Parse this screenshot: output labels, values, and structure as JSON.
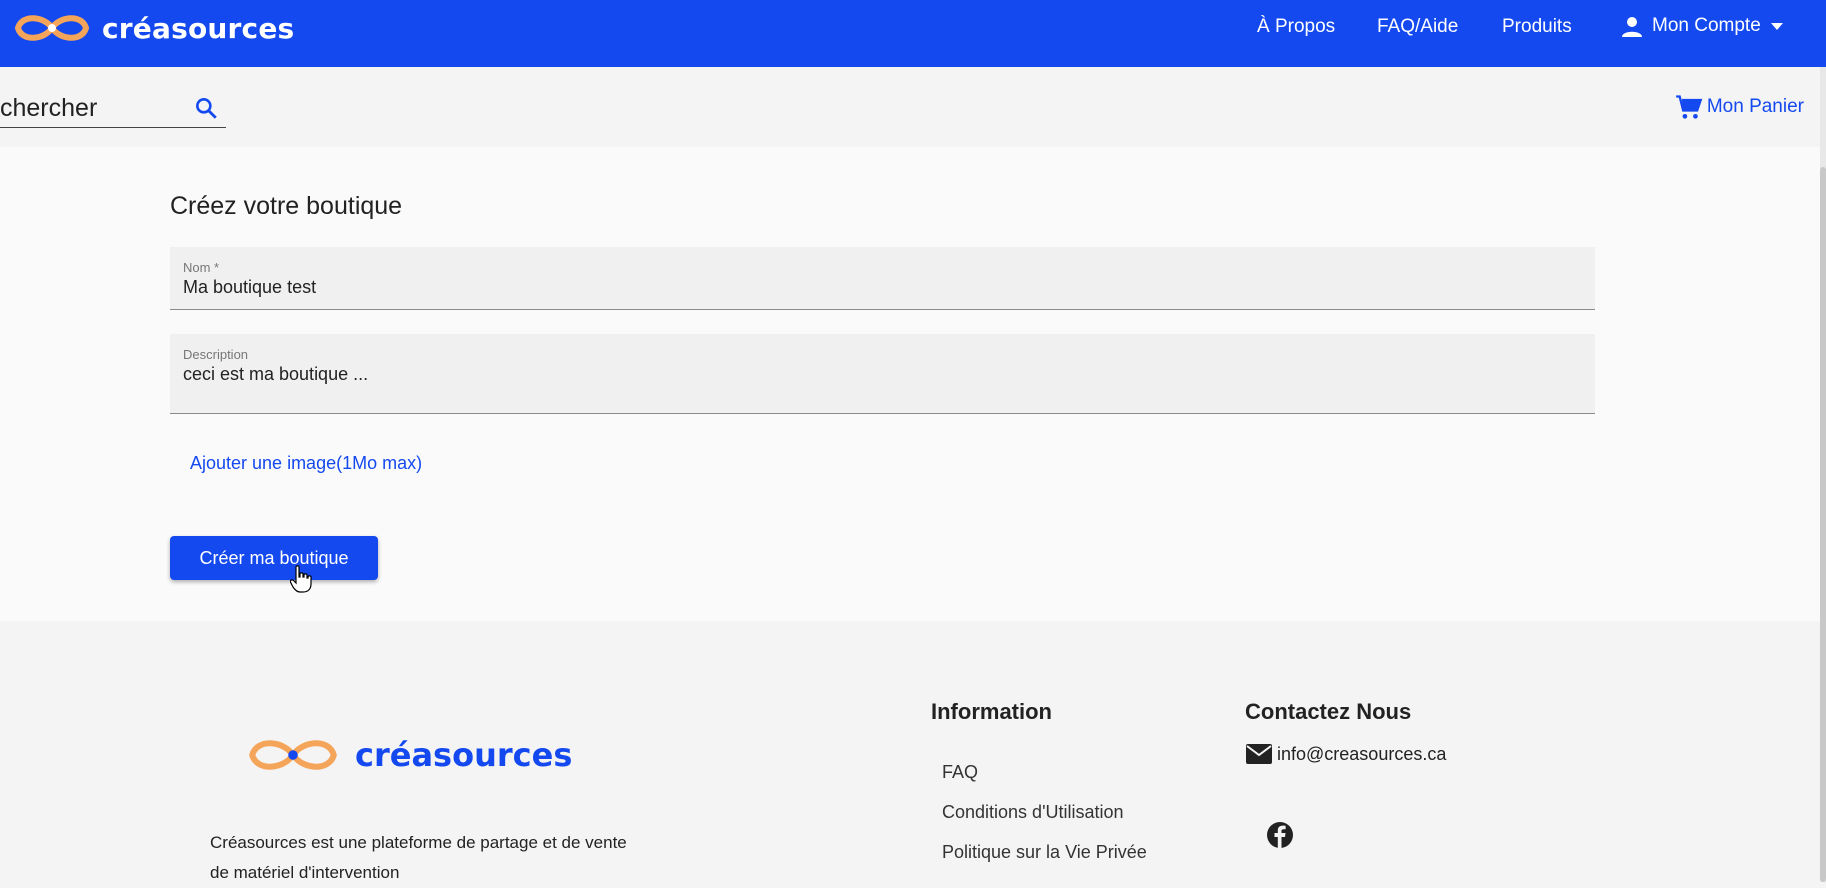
{
  "header": {
    "brand": "créasources",
    "nav": {
      "about": "À Propos",
      "faq": "FAQ/Aide",
      "products": "Produits",
      "account": "Mon Compte"
    }
  },
  "subbar": {
    "search_placeholder": "chercher",
    "cart_label": "Mon Panier"
  },
  "form": {
    "title": "Créez votre boutique",
    "name_label": "Nom *",
    "name_value": "Ma boutique test",
    "description_label": "Description",
    "description_value": "ceci est ma boutique ...",
    "upload_link": "Ajouter une image(1Mo max)",
    "submit_label": "Créer ma boutique"
  },
  "footer": {
    "brand": "créasources",
    "description": "Créasources est une plateforme de partage et de vente de matériel d'intervention",
    "information_heading": "Information",
    "links": [
      "FAQ",
      "Conditions d'Utilisation",
      "Politique sur la Vie Privée"
    ],
    "contact_heading": "Contactez Nous",
    "email": "info@creasources.ca"
  },
  "colors": {
    "primary": "#1449f0",
    "logo_orange": "#f5a55a"
  },
  "icons": [
    "infinity-logo-icon",
    "account-icon",
    "caret-down-icon",
    "search-icon",
    "cart-icon",
    "mail-icon",
    "facebook-icon",
    "hand-pointer-icon"
  ]
}
